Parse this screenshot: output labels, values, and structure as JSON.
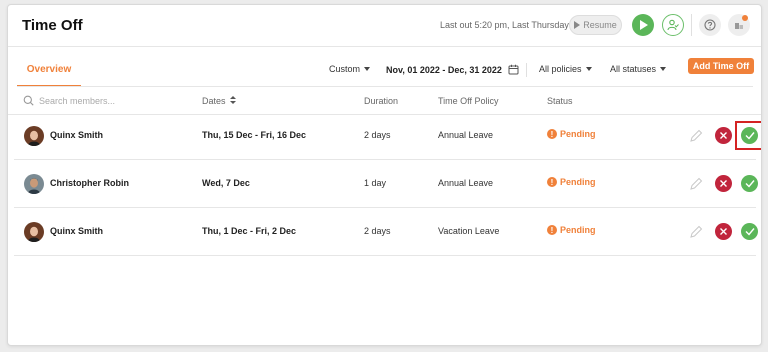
{
  "header": {
    "title": "Time Off",
    "last_out": "Last out 5:20 pm, Last Thursday",
    "resume_label": "Resume"
  },
  "tabs": [
    {
      "label": "Overview",
      "active": true
    }
  ],
  "filters": {
    "range": "Custom",
    "dates": "Nov, 01 2022 - Dec, 31 2022",
    "policies": "All policies",
    "statuses": "All statuses",
    "add_label": "Add Time Off"
  },
  "table": {
    "search_placeholder": "Search members...",
    "columns": {
      "dates": "Dates",
      "duration": "Duration",
      "policy": "Time Off Policy",
      "status": "Status"
    },
    "rows": [
      {
        "name": "Quinx Smith",
        "dates": "Thu, 15 Dec - Fri, 16 Dec",
        "duration": "2 days",
        "policy": "Annual Leave",
        "status": "Pending"
      },
      {
        "name": "Christopher Robin",
        "dates": "Wed, 7 Dec",
        "duration": "1 day",
        "policy": "Annual Leave",
        "status": "Pending"
      },
      {
        "name": "Quinx Smith",
        "dates": "Thu, 1 Dec - Fri, 2 Dec",
        "duration": "2 days",
        "policy": "Vacation Leave",
        "status": "Pending"
      }
    ]
  },
  "colors": {
    "accent": "#f0813a",
    "approve": "#5bb659",
    "reject": "#c1253c",
    "highlight": "#d42323"
  },
  "icons": [
    "play-icon",
    "user-check-icon",
    "help-icon",
    "notifications-icon",
    "calendar-icon",
    "search-icon",
    "sort-icon",
    "pencil-icon",
    "reject-icon",
    "approve-icon",
    "alert-icon"
  ]
}
